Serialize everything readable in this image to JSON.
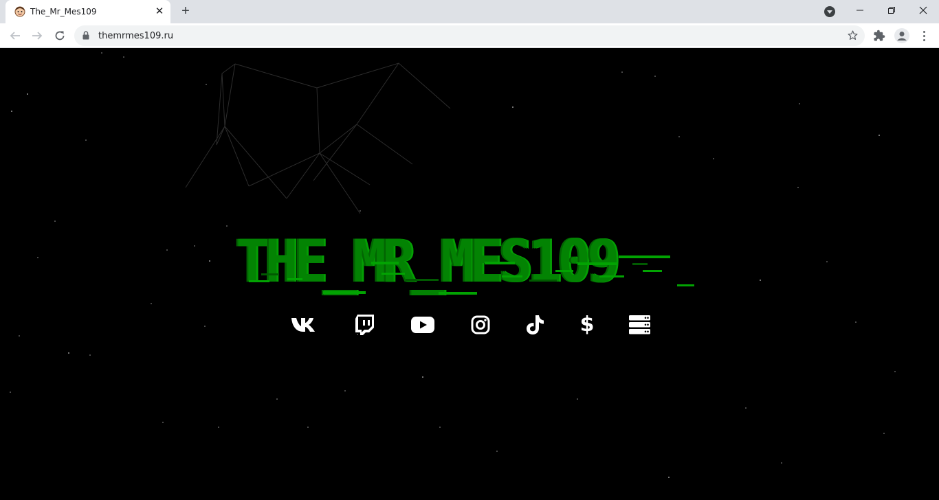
{
  "browser": {
    "tab": {
      "title": "The_Mr_Mes109",
      "favicon": "face-favicon-icon"
    },
    "address_bar": {
      "url": "themrmes109.ru"
    }
  },
  "page": {
    "title": "THE_MR_MES109",
    "title_color": "#038303",
    "background_color": "#000000",
    "social_links": [
      {
        "name": "vk",
        "icon": "vk-icon"
      },
      {
        "name": "twitch",
        "icon": "twitch-icon"
      },
      {
        "name": "youtube",
        "icon": "youtube-icon"
      },
      {
        "name": "instagram",
        "icon": "instagram-icon"
      },
      {
        "name": "tiktok",
        "icon": "tiktok-icon"
      },
      {
        "name": "donate",
        "icon": "dollar-icon",
        "glyph": "$"
      },
      {
        "name": "server",
        "icon": "server-icon"
      }
    ]
  }
}
